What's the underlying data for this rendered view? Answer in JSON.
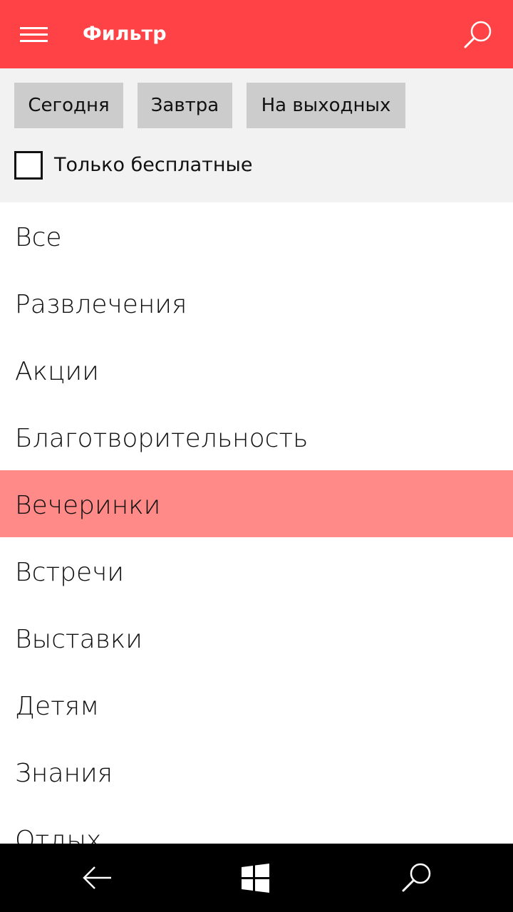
{
  "header": {
    "title": "Фильтр",
    "menu_icon": "hamburger-menu-icon",
    "search_icon": "search-icon",
    "background_color": "#ff4245"
  },
  "filters": {
    "chips": [
      {
        "label": "Сегодня"
      },
      {
        "label": "Завтра"
      },
      {
        "label": "На выходных"
      }
    ],
    "free_only": {
      "label": "Только бесплатные",
      "checked": false
    }
  },
  "categories": {
    "items": [
      {
        "label": "Все"
      },
      {
        "label": "Развлечения"
      },
      {
        "label": "Акции"
      },
      {
        "label": "Благотворительность"
      },
      {
        "label": "Вечеринки",
        "selected": true
      },
      {
        "label": "Встречи"
      },
      {
        "label": "Выставки"
      },
      {
        "label": "Детям"
      },
      {
        "label": "Знания"
      },
      {
        "label": "Отдых"
      }
    ],
    "selected_color": "#ff8a88"
  },
  "navbar": {
    "back_icon": "back-arrow-icon",
    "home_icon": "windows-logo-icon",
    "search_icon": "search-icon"
  }
}
